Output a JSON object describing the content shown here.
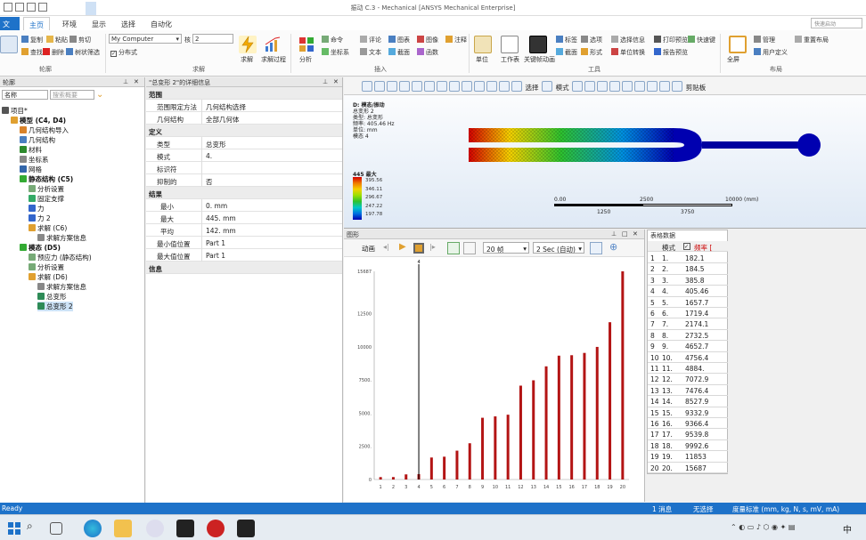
{
  "window": {
    "title": "振动 C.3 - Mechanical [ANSYS Mechanical Enterprise]"
  },
  "tabs": [
    "文件",
    "主页",
    "环境",
    "显示",
    "选择",
    "自动化",
    "环境"
  ],
  "search": {
    "placeholder": "快速启动"
  },
  "ribbon": {
    "outline_group": {
      "label": "轮廓",
      "items": [
        "复制",
        "粘贴",
        "剪切",
        "删除",
        "查找",
        "树状筛选"
      ]
    },
    "solve_group": {
      "label": "求解",
      "computer": "My Computer",
      "cores_label": "核",
      "cores_value": "2",
      "distributed": "分布式",
      "solve": "求解",
      "process": "求解过程"
    },
    "insert_group": {
      "label": "插入",
      "items": [
        "分析",
        "命令",
        "注释",
        "评论",
        "图表",
        "坐标系",
        "截面",
        "图像",
        "文本",
        "网格编号",
        "函数"
      ]
    },
    "tools_group": {
      "label": "工具",
      "items": [
        "单位",
        "工作表",
        "关键帧动画",
        "标签",
        "选项",
        "选择信息",
        "打印预览",
        "快速键",
        "截面",
        "形式",
        "选择信息",
        "单位转换",
        "报告预览"
      ]
    },
    "layout_group": {
      "label": "布局",
      "items": [
        "全屏",
        "管理",
        "用户定义",
        "重置布局"
      ]
    }
  },
  "outline": {
    "header": "轮廓",
    "filter_label": "名称",
    "search_placeholder": "搜索概要",
    "tree": [
      {
        "label": "项目*",
        "level": 0
      },
      {
        "label": "模型 (C4, D4)",
        "level": 1
      },
      {
        "label": "几何结构导入",
        "level": 2
      },
      {
        "label": "几何结构",
        "level": 2
      },
      {
        "label": "材料",
        "level": 2
      },
      {
        "label": "坐标系",
        "level": 2
      },
      {
        "label": "网格",
        "level": 2
      },
      {
        "label": "静态结构 (C5)",
        "level": 2
      },
      {
        "label": "分析设置",
        "level": 3
      },
      {
        "label": "固定支撑",
        "level": 3
      },
      {
        "label": "力",
        "level": 3
      },
      {
        "label": "力 2",
        "level": 3
      },
      {
        "label": "求解 (C6)",
        "level": 3
      },
      {
        "label": "求解方案信息",
        "level": 4
      },
      {
        "label": "模态 (D5)",
        "level": 2
      },
      {
        "label": "预应力 (静态结构)",
        "level": 3
      },
      {
        "label": "分析设置",
        "level": 3
      },
      {
        "label": "求解 (D6)",
        "level": 3
      },
      {
        "label": "求解方案信息",
        "level": 4
      },
      {
        "label": "总变形",
        "level": 4
      },
      {
        "label": "总变形 2",
        "level": 4
      }
    ]
  },
  "details": {
    "header": "\"总变形 2\"的详细信息",
    "rows": [
      {
        "type": "sec",
        "k": "范围"
      },
      {
        "type": "row",
        "k": "范围限定方法",
        "v": "几何结构选择"
      },
      {
        "type": "row",
        "k": "几何结构",
        "v": "全部几何体"
      },
      {
        "type": "sec",
        "k": "定义"
      },
      {
        "type": "row",
        "k": "类型",
        "v": "总变形"
      },
      {
        "type": "row",
        "k": "模式",
        "v": "4."
      },
      {
        "type": "row",
        "k": "标识符",
        "v": ""
      },
      {
        "type": "row",
        "k": "抑制的",
        "v": "否"
      },
      {
        "type": "sec",
        "k": "结果"
      },
      {
        "type": "sub",
        "k": "最小",
        "v": "0. mm"
      },
      {
        "type": "sub",
        "k": "最大",
        "v": "445. mm"
      },
      {
        "type": "sub",
        "k": "平均",
        "v": "142. mm"
      },
      {
        "type": "row",
        "k": "最小值位置",
        "v": "Part 1"
      },
      {
        "type": "row",
        "k": "最大值位置",
        "v": "Part 1"
      },
      {
        "type": "sec",
        "k": "信息"
      }
    ]
  },
  "viewer": {
    "info_lines": [
      "D: 模态/振动",
      "总变形 2",
      "类型: 总变形",
      "频率: 405.46 Hz",
      "单位: mm",
      "模态 4"
    ],
    "legend_title": "445 最大",
    "legend_values": [
      "395.56",
      "346.11",
      "296.67",
      "247.22",
      "197.78"
    ],
    "scale_labels": [
      "0.00",
      "2500",
      "5000",
      "10000 (mm)",
      "1250",
      "3750"
    ],
    "select_label": "选择",
    "mode_label": "模式",
    "print_label": "剪贴板"
  },
  "graph": {
    "header": "图形",
    "animation_label": "动画",
    "frames": "20 帧",
    "duration": "2 Sec (自动)",
    "selected_mode": "4"
  },
  "chart_data": {
    "type": "bar",
    "categories": [
      "1",
      "2",
      "3",
      "4",
      "5",
      "6",
      "7",
      "8",
      "9",
      "10",
      "11",
      "12",
      "13",
      "14",
      "15",
      "16",
      "17",
      "18",
      "19",
      "20"
    ],
    "values": [
      182.1,
      184.5,
      385.8,
      405.46,
      1657.7,
      1719.4,
      2174.1,
      2732.5,
      4652.7,
      4756.4,
      4884,
      7072.9,
      7476.4,
      8527.9,
      9332.9,
      9366.4,
      9539.8,
      9992.6,
      11853,
      15687
    ],
    "ylim": [
      0,
      15687
    ],
    "yticks": [
      "0",
      "2500.",
      "5000.",
      "7500.",
      "10000",
      "12500",
      "15687"
    ],
    "color": "#b31414"
  },
  "table": {
    "header": "表格数据",
    "col_mode": "模式",
    "col_freq": "频率 [",
    "rows": [
      [
        "1.",
        "182.1"
      ],
      [
        "2.",
        "184.5"
      ],
      [
        "3.",
        "385.8"
      ],
      [
        "4.",
        "405.46"
      ],
      [
        "5.",
        "1657.7"
      ],
      [
        "6.",
        "1719.4"
      ],
      [
        "7.",
        "2174.1"
      ],
      [
        "8.",
        "2732.5"
      ],
      [
        "9.",
        "4652.7"
      ],
      [
        "10.",
        "4756.4"
      ],
      [
        "11.",
        "4884."
      ],
      [
        "12.",
        "7072.9"
      ],
      [
        "13.",
        "7476.4"
      ],
      [
        "14.",
        "8527.9"
      ],
      [
        "15.",
        "9332.9"
      ],
      [
        "16.",
        "9366.4"
      ],
      [
        "17.",
        "9539.8"
      ],
      [
        "18.",
        "9992.6"
      ],
      [
        "19.",
        "11853"
      ],
      [
        "20.",
        "15687"
      ]
    ]
  },
  "status": {
    "left": "Ready",
    "messages": "1 消息",
    "selection": "无选择",
    "units": "度量标准 (mm, kg, N, s, mV, mA)"
  },
  "taskbar": {
    "lang": "中"
  },
  "colors": {
    "accent": "#1e72c9",
    "bar": "#b31414"
  }
}
